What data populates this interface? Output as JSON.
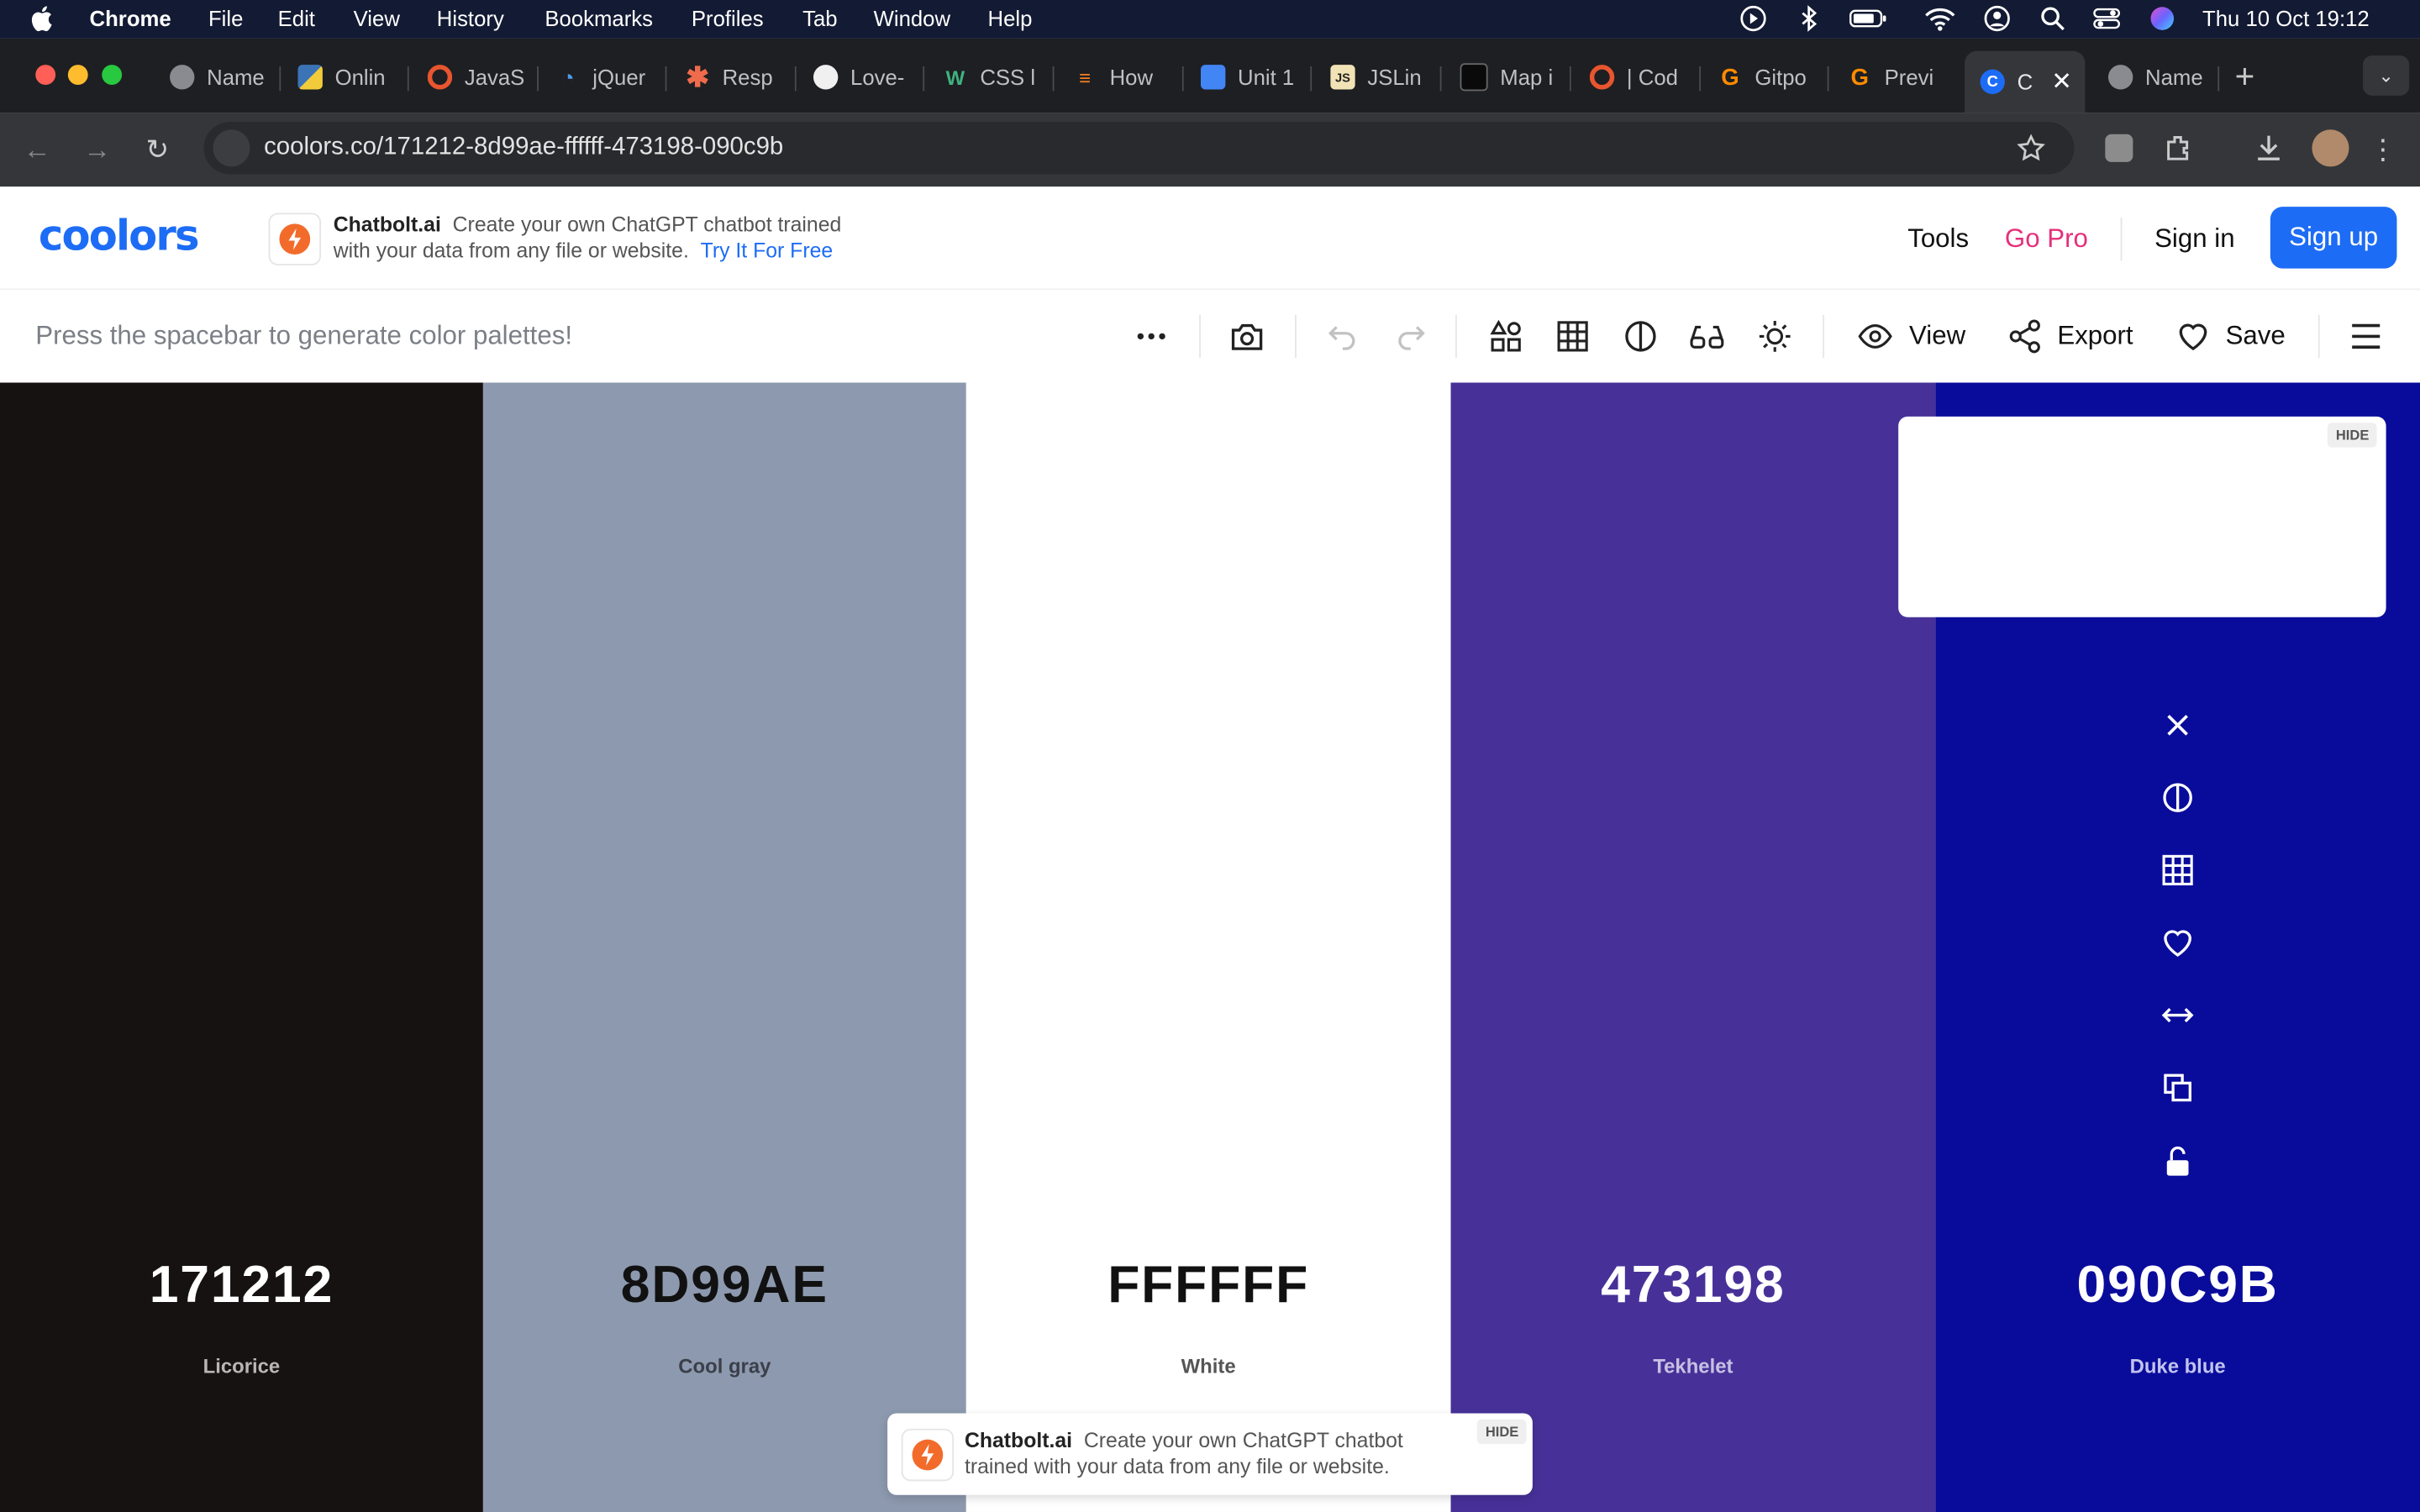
{
  "menubar": {
    "app": "Chrome",
    "items": [
      "File",
      "Edit",
      "View",
      "History",
      "Bookmarks",
      "Profiles",
      "Tab",
      "Window",
      "Help"
    ],
    "clock": "Thu 10 Oct  19:12"
  },
  "tabs": [
    {
      "title": "Name",
      "icon": "globe-icon"
    },
    {
      "title": "Onlin",
      "icon": "python-icon"
    },
    {
      "title": "JavaS",
      "icon": "circle-icon"
    },
    {
      "title": "jQuer",
      "icon": "jquery-icon"
    },
    {
      "title": "Resp",
      "icon": "asterisk-icon"
    },
    {
      "title": "Love-",
      "icon": "github-icon"
    },
    {
      "title": "CSS l",
      "icon": "w-icon"
    },
    {
      "title": "How",
      "icon": "stackoverflow-icon"
    },
    {
      "title": "Unit 1",
      "icon": "docs-icon"
    },
    {
      "title": "JSLin",
      "icon": "jslint-icon"
    },
    {
      "title": "Map i",
      "icon": "map-icon"
    },
    {
      "title": "| Cod",
      "icon": "circle-icon"
    },
    {
      "title": "Gitpo",
      "icon": "gitpod-icon"
    },
    {
      "title": "Previ",
      "icon": "gitpod-icon"
    },
    {
      "title": "C",
      "icon": "coolors-icon",
      "active": true
    },
    {
      "title": "Name",
      "icon": "globe-icon"
    }
  ],
  "browser": {
    "url": "coolors.co/171212-8d99ae-ffffff-473198-090c9b"
  },
  "header": {
    "logo": "coolors",
    "ad": {
      "brand": "Chatbolt.ai",
      "text_line1": "Create your own ChatGPT chatbot trained",
      "text_line2": "with your data from any file or website.",
      "link": "Try It For Free"
    },
    "nav": {
      "tools": "Tools",
      "gopro": "Go Pro",
      "signin": "Sign in",
      "signup": "Sign up"
    }
  },
  "toolbar": {
    "hint": "Press the spacebar to generate color palettes!",
    "view": "View",
    "export": "Export",
    "save": "Save"
  },
  "palette": [
    {
      "hex": "171212",
      "name": "Licorice",
      "color": "#171212",
      "text_color": "#ffffff",
      "name_color": "#b9b6b6"
    },
    {
      "hex": "8D99AE",
      "name": "Cool gray",
      "color": "#8d99ae",
      "text_color": "#111111",
      "name_color": "#3a3f49"
    },
    {
      "hex": "FFFFFF",
      "name": "White",
      "color": "#ffffff",
      "text_color": "#111111",
      "name_color": "#555555"
    },
    {
      "hex": "473198",
      "name": "Tekhelet",
      "color": "#473198",
      "text_color": "#ffffff",
      "name_color": "#c7c0e3"
    },
    {
      "hex": "090C9B",
      "name": "Duke blue",
      "color": "#090c9b",
      "text_color": "#ffffff",
      "name_color": "#c1c3ee"
    }
  ],
  "side_panel": {
    "hide": "HIDE",
    "icons": [
      "close-icon",
      "contrast-icon",
      "grid-icon",
      "heart-icon",
      "drag-icon",
      "copy-icon",
      "lock-icon"
    ]
  },
  "bottom_ad": {
    "brand": "Chatbolt.ai",
    "text": "Create your own ChatGPT chatbot trained with your data from any file or website.",
    "hide": "HIDE"
  }
}
